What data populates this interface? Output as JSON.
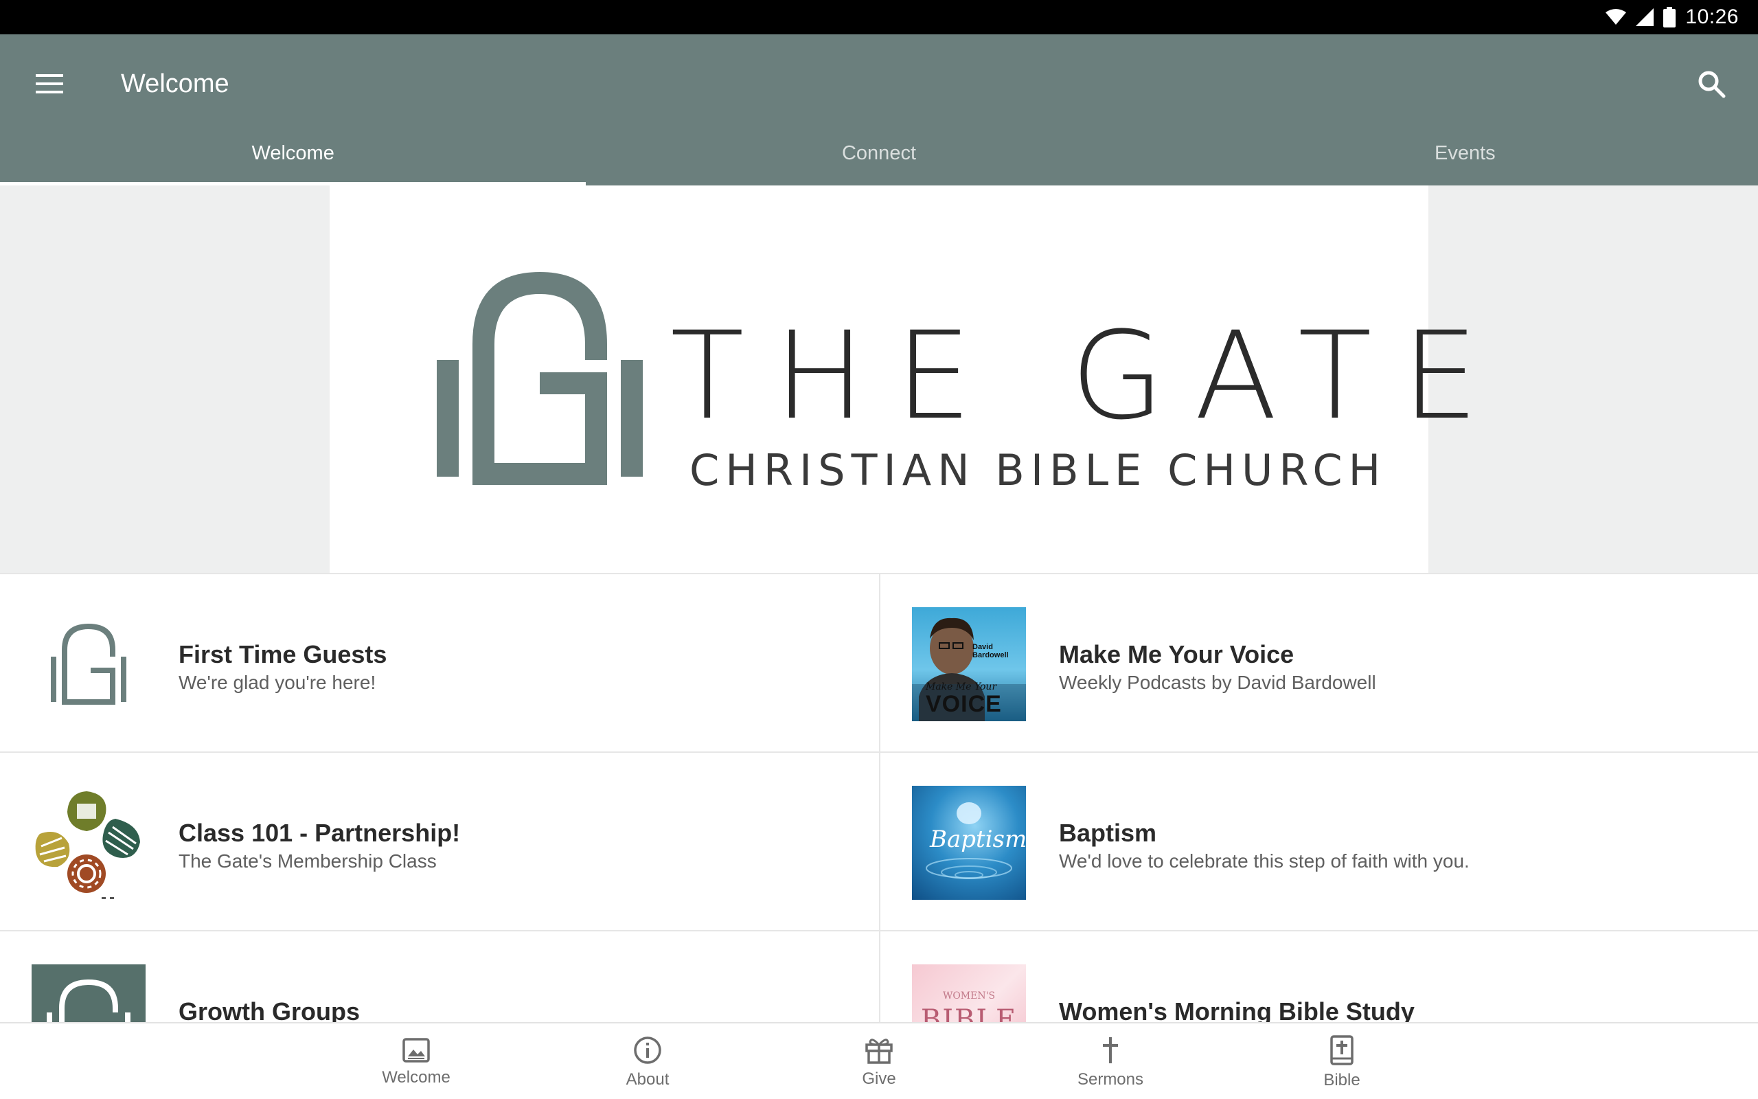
{
  "status_bar": {
    "time": "10:26"
  },
  "app_bar": {
    "title": "Welcome"
  },
  "tabs": [
    {
      "label": "Welcome",
      "active": true
    },
    {
      "label": "Connect",
      "active": false
    },
    {
      "label": "Events",
      "active": false
    }
  ],
  "banner": {
    "wordmark": "THE GATE",
    "subline": "CHRISTIAN BIBLE CHURCH",
    "brand_color": "#6b7f7d"
  },
  "cards": [
    {
      "title": "First Time Guests",
      "subtitle": "We're glad you're here!",
      "thumb": "gate-logo"
    },
    {
      "title": "Make Me Your Voice",
      "subtitle": "Weekly Podcasts by David Bardowell",
      "thumb": "podcast-cover",
      "thumb_text": {
        "name": "David Bardowell",
        "script": "Make Me Your",
        "big": "VOICE"
      }
    },
    {
      "title": "Class 101 - Partnership!",
      "subtitle": "The Gate's Membership Class",
      "thumb": "class-101-logo"
    },
    {
      "title": "Baptism",
      "subtitle": "We'd love to celebrate this step of faith with you.",
      "thumb": "baptism-cover",
      "thumb_text": {
        "script": "Baptism"
      }
    },
    {
      "title": "Growth Groups",
      "subtitle": "",
      "thumb": "growth-groups-cover"
    },
    {
      "title": "Women's Morning Bible Study",
      "subtitle": "",
      "thumb": "womens-bible-cover",
      "thumb_text": {
        "small": "WOMEN'S",
        "big": "BIBLE"
      }
    }
  ],
  "bottom_nav": [
    {
      "label": "Welcome",
      "icon": "image-icon"
    },
    {
      "label": "About",
      "icon": "info-icon"
    },
    {
      "label": "Give",
      "icon": "gift-icon"
    },
    {
      "label": "Sermons",
      "icon": "cross-icon"
    },
    {
      "label": "Bible",
      "icon": "bible-icon"
    }
  ]
}
